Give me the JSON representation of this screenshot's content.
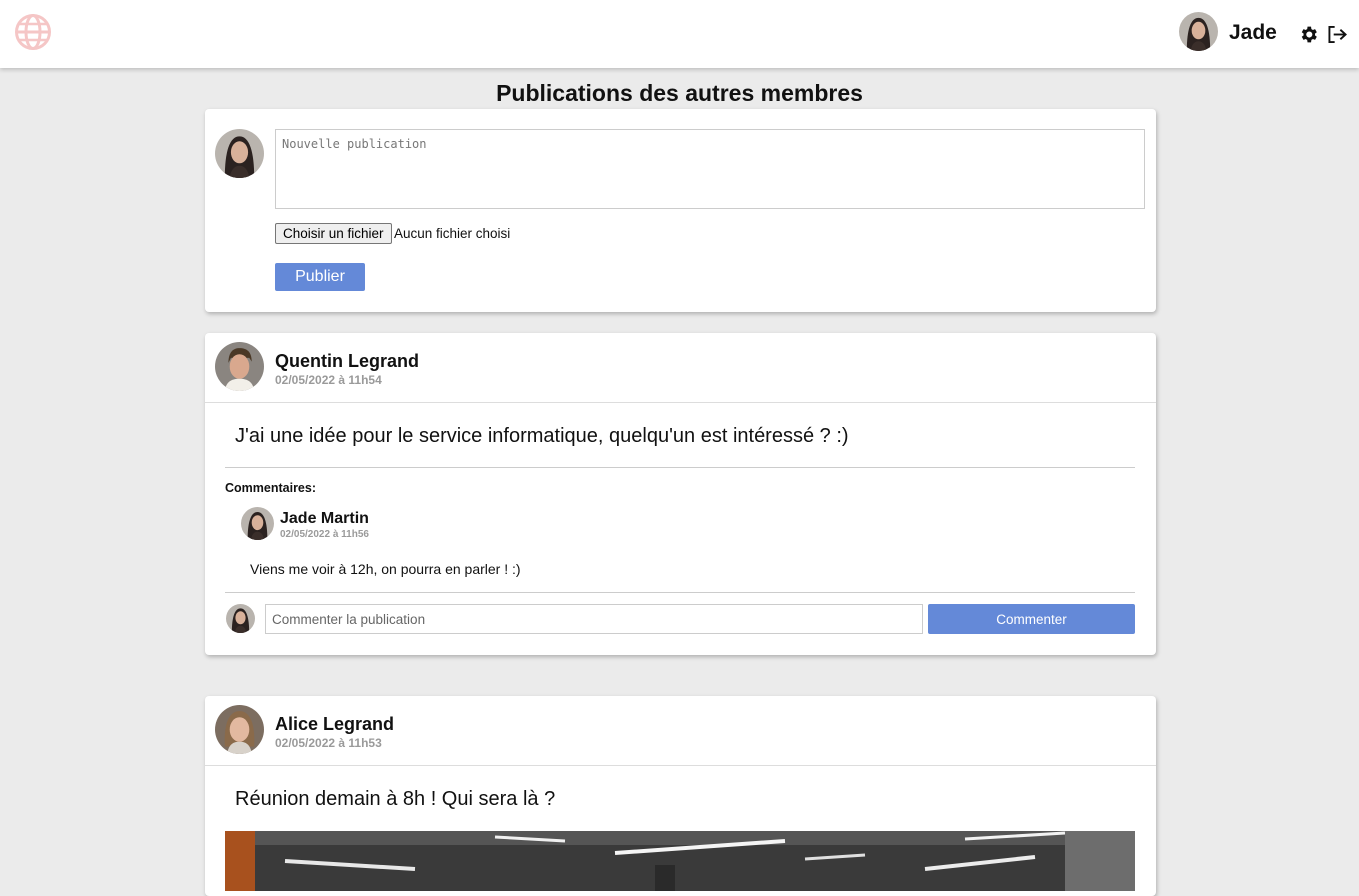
{
  "header": {
    "username": "Jade",
    "logo_icon": "globe-icon",
    "settings_icon": "gear-icon",
    "logout_icon": "logout-icon"
  },
  "page": {
    "title": "Publications des autres membres"
  },
  "composer": {
    "placeholder": "Nouvelle publication",
    "file_button": "Choisir un fichier",
    "file_status": "Aucun fichier choisi",
    "publish_button": "Publier"
  },
  "posts": [
    {
      "author": "Quentin Legrand",
      "date": "02/05/2022 à 11h54",
      "text": "J'ai une idée pour le service informatique, quelqu'un est intéressé ? :)",
      "comments_label": "Commentaires:",
      "comments": [
        {
          "author": "Jade Martin",
          "date": "02/05/2022 à 11h56",
          "text": "Viens me voir à 12h, on pourra en parler ! :)"
        }
      ],
      "comment_placeholder": "Commenter la publication",
      "comment_button": "Commenter"
    },
    {
      "author": "Alice Legrand",
      "date": "02/05/2022 à 11h53",
      "text": "Réunion demain à 8h ! Qui sera là ?"
    }
  ],
  "colors": {
    "accent": "#6489d8",
    "logo": "#f5c6c6",
    "background": "#ebebeb"
  }
}
